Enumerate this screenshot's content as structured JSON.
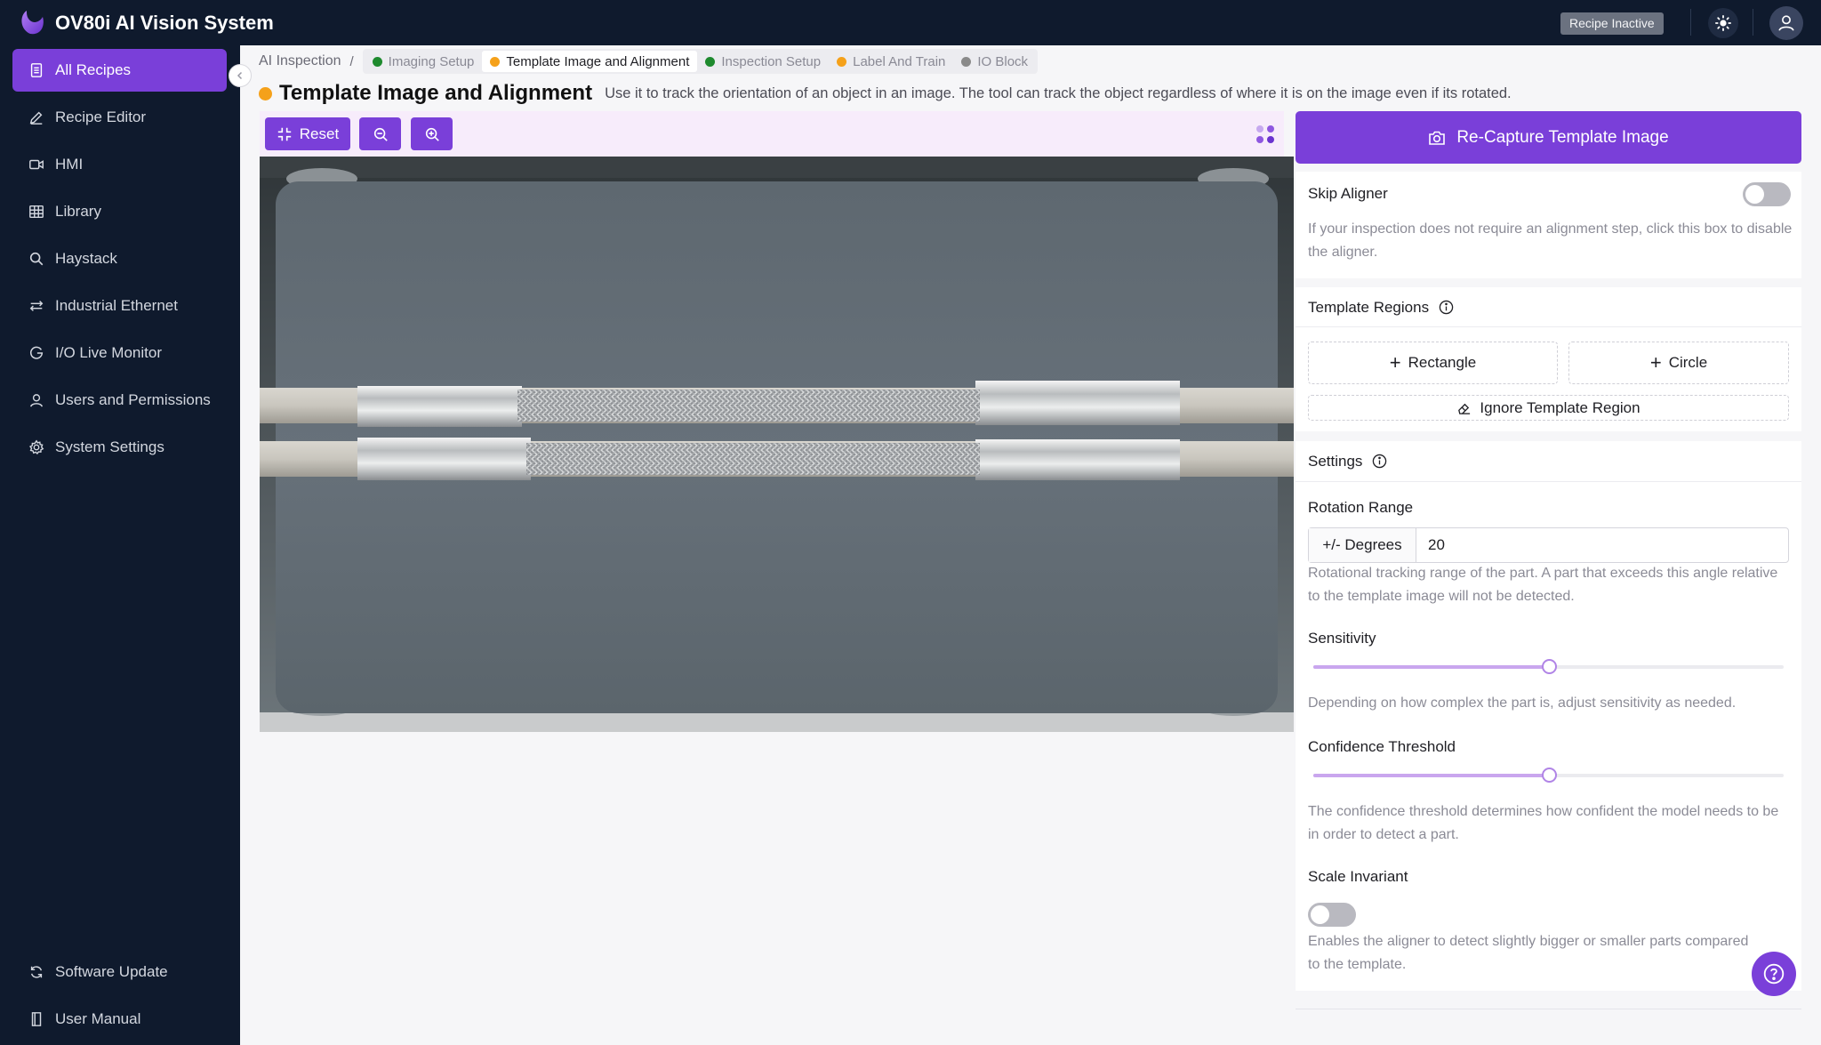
{
  "app": {
    "title": "OV80i AI Vision System",
    "recipe_status": "Recipe Inactive"
  },
  "icons": {
    "logo": "ov-logo-icon",
    "theme": "sun-icon",
    "user": "user-icon",
    "collapse": "chevron-left-icon",
    "help": "question-circle-icon"
  },
  "sidebar": {
    "items": [
      {
        "label": "All Recipes",
        "icon": "document-list-icon",
        "active": true
      },
      {
        "label": "Recipe Editor",
        "icon": "pencil-icon"
      },
      {
        "label": "HMI",
        "icon": "video-icon"
      },
      {
        "label": "Library",
        "icon": "grid-table-icon"
      },
      {
        "label": "Haystack",
        "icon": "search-icon"
      },
      {
        "label": "Industrial Ethernet",
        "icon": "ethernet-icon"
      },
      {
        "label": "I/O Live Monitor",
        "icon": "io-monitor-icon"
      },
      {
        "label": "Users and Permissions",
        "icon": "user-icon"
      },
      {
        "label": "System Settings",
        "icon": "gear-icon"
      }
    ],
    "footer": [
      {
        "label": "Software Update",
        "icon": "refresh-icon"
      },
      {
        "label": "User Manual",
        "icon": "book-icon"
      }
    ]
  },
  "breadcrumb": {
    "root": "AI Inspection",
    "separator": "/",
    "steps": [
      {
        "label": "Imaging Setup",
        "color": "#1e8a2e"
      },
      {
        "label": "Template Image and Alignment",
        "color": "#f5a11a",
        "current": true
      },
      {
        "label": "Inspection Setup",
        "color": "#1e8a2e"
      },
      {
        "label": "Label And Train",
        "color": "#f5a11a"
      },
      {
        "label": "IO Block",
        "color": "#8a8a8a"
      }
    ]
  },
  "header": {
    "title": "Template Image and Alignment",
    "description": "Use it to track the orientation of an object in an image. The tool can track the object regardless of where it is on the image even if its rotated."
  },
  "viewer": {
    "reset_label": "Reset",
    "zoom_out_icon": "zoom-out-icon",
    "zoom_in_icon": "zoom-in-icon",
    "reset_icon": "collapse-arrows-icon"
  },
  "panel": {
    "recapture_label": "Re-Capture Template Image",
    "skip_aligner": {
      "label": "Skip Aligner",
      "enabled": false,
      "help": "If your inspection does not require an alignment step, click this box to disable the aligner."
    },
    "template_regions": {
      "title": "Template Regions",
      "rectangle_label": "Rectangle",
      "circle_label": "Circle",
      "ignore_label": "Ignore Template Region"
    },
    "settings": {
      "title": "Settings",
      "rotation_range_label": "Rotation Range",
      "rotation_addon": "+/- Degrees",
      "rotation_value": "20",
      "rotation_help": "Rotational tracking range of the part. A part that exceeds this angle relative to the template image will not be detected.",
      "sensitivity_label": "Sensitivity",
      "sensitivity_value": 0.5,
      "sensitivity_help": "Depending on how complex the part is, adjust sensitivity as needed.",
      "confidence_label": "Confidence Threshold",
      "confidence_value": 0.5,
      "confidence_help": "The confidence threshold determines how confident the model needs to be in order to detect a part.",
      "scale_label": "Scale Invariant",
      "scale_enabled": false,
      "scale_help": "Enables the aligner to detect slightly bigger or smaller parts compared to the template."
    }
  },
  "colors": {
    "accent": "#7a3fd9",
    "navy": "#0f1a2d",
    "pending": "#f5a11a",
    "done": "#1e8a2e"
  }
}
